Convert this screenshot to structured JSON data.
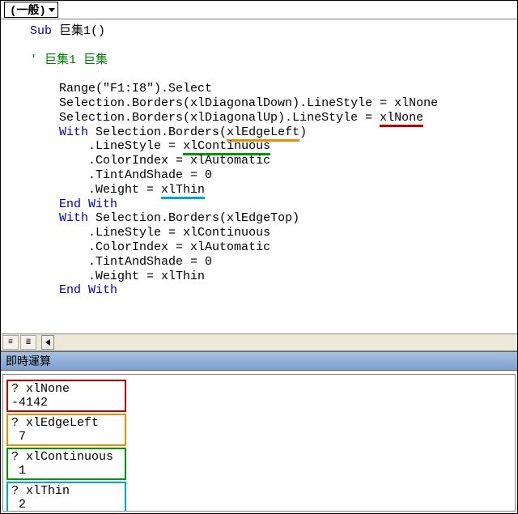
{
  "titlebar": {
    "module": "(一般)"
  },
  "code": {
    "sub": "Sub",
    "subName": "巨集1()",
    "commentMark": "'",
    "commentText": "巨集1 巨集",
    "l1": "Range(\"F1:I8\").Select",
    "l2a": "Selection.Borders(xlDiagonalDown).LineStyle = xlNone",
    "l3pre": "Selection.Borders(xlDiagonalUp).LineStyle = ",
    "l3ul": "xlNone",
    "with": "With",
    "l4mid": " Selection.Borders(",
    "l4ul": "xlEdgeLeft",
    "l4end": ")",
    "l5pre": ".LineStyle = ",
    "l5ul": "xlContinuous",
    "l6": ".ColorIndex = xlAutomatic",
    "l7": ".TintAndShade = 0",
    "l8pre": ".Weight = ",
    "l8ul": "xlThin",
    "endwith": "End With",
    "l10mid": " Selection.Borders(xlEdgeTop)",
    "l11": ".LineStyle = xlContinuous",
    "l12": ".ColorIndex = xlAutomatic",
    "l13": ".TintAndShade = 0",
    "l14": ".Weight = xlThin"
  },
  "immediate": {
    "title": "即時運算",
    "box1q": "? xlNone",
    "box1a": "-4142",
    "box2q": "? xlEdgeLeft",
    "box2a": " 7",
    "box3q": "? xlContinuous",
    "box3a": " 1",
    "box4q": "? xlThin",
    "box4a": " 2"
  }
}
